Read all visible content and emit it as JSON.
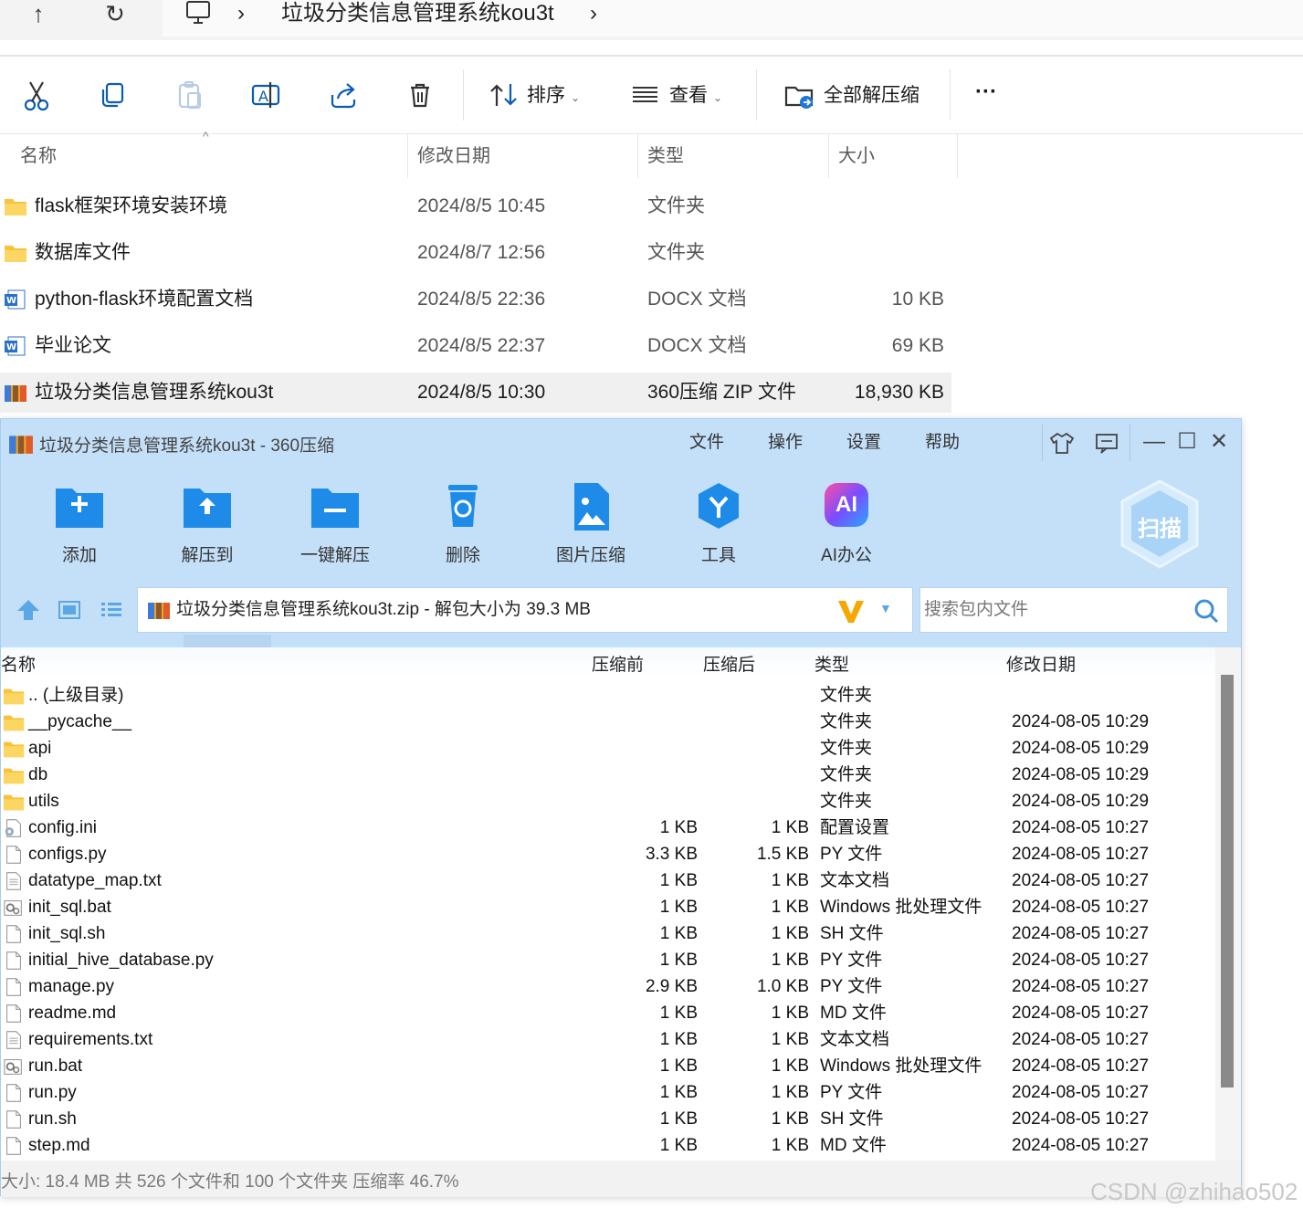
{
  "explorer": {
    "breadcrumb": {
      "segment": "垃圾分类信息管理系统kou3t"
    },
    "nav": {
      "up": "↑",
      "refresh": "↻",
      "sep1": "›",
      "sep2": "›"
    },
    "commands": {
      "sort_label": "排序",
      "view_label": "查看",
      "extract_all_label": "全部解压缩",
      "more_label": "···"
    },
    "columns": {
      "name": "名称",
      "date": "修改日期",
      "type": "类型",
      "size": "大小"
    },
    "files": [
      {
        "name": "flask框架环境安装环境",
        "date": "2024/8/5 10:45",
        "type": "文件夹",
        "size": "",
        "icon": "folder-icon"
      },
      {
        "name": "数据库文件",
        "date": "2024/8/7 12:56",
        "type": "文件夹",
        "size": "",
        "icon": "folder-icon"
      },
      {
        "name": "python-flask环境配置文档",
        "date": "2024/8/5 22:36",
        "type": "DOCX 文档",
        "size": "10 KB",
        "icon": "word-doc-icon"
      },
      {
        "name": "毕业论文",
        "date": "2024/8/5 22:37",
        "type": "DOCX 文档",
        "size": "69 KB",
        "icon": "word-doc-icon"
      },
      {
        "name": "垃圾分类信息管理系统kou3t",
        "date": "2024/8/5 10:30",
        "type": "360压缩 ZIP 文件",
        "size": "18,930 KB",
        "icon": "zip-archive-icon",
        "selected": true
      }
    ]
  },
  "zip": {
    "title": "垃圾分类信息管理系统kou3t - 360压缩",
    "menu": [
      "文件",
      "操作",
      "设置",
      "帮助"
    ],
    "window_controls": {
      "minimize": "—",
      "maximize": "☐",
      "close": "✕"
    },
    "toolbar": [
      "添加",
      "解压到",
      "一键解压",
      "删除",
      "图片压缩",
      "工具",
      "AI办公"
    ],
    "scan_label": "扫描",
    "ai_badge": "AI",
    "path_text": "垃圾分类信息管理系统kou3t.zip - 解包大小为 39.3 MB",
    "search_placeholder": "搜索包内文件",
    "columns": {
      "name": "名称",
      "before": "压缩前",
      "after": "压缩后",
      "type": "类型",
      "date": "修改日期"
    },
    "rows": [
      {
        "name": ".. (上级目录)",
        "before": "",
        "after": "",
        "type": "文件夹",
        "date": "",
        "icon": "folder-icon"
      },
      {
        "name": "__pycache__",
        "before": "",
        "after": "",
        "type": "文件夹",
        "date": "2024-08-05 10:29",
        "icon": "folder-icon"
      },
      {
        "name": "api",
        "before": "",
        "after": "",
        "type": "文件夹",
        "date": "2024-08-05 10:29",
        "icon": "folder-icon"
      },
      {
        "name": "db",
        "before": "",
        "after": "",
        "type": "文件夹",
        "date": "2024-08-05 10:29",
        "icon": "folder-icon"
      },
      {
        "name": "utils",
        "before": "",
        "after": "",
        "type": "文件夹",
        "date": "2024-08-05 10:29",
        "icon": "folder-icon"
      },
      {
        "name": "config.ini",
        "before": "1 KB",
        "after": "1 KB",
        "type": "配置设置",
        "date": "2024-08-05 10:27",
        "icon": "settings-file-icon"
      },
      {
        "name": "configs.py",
        "before": "3.3 KB",
        "after": "1.5 KB",
        "type": "PY 文件",
        "date": "2024-08-05 10:27",
        "icon": "file-icon"
      },
      {
        "name": "datatype_map.txt",
        "before": "1 KB",
        "after": "1 KB",
        "type": "文本文档",
        "date": "2024-08-05 10:27",
        "icon": "text-file-icon"
      },
      {
        "name": "init_sql.bat",
        "before": "1 KB",
        "after": "1 KB",
        "type": "Windows 批处理文件",
        "date": "2024-08-05 10:27",
        "icon": "batch-file-icon"
      },
      {
        "name": "init_sql.sh",
        "before": "1 KB",
        "after": "1 KB",
        "type": "SH 文件",
        "date": "2024-08-05 10:27",
        "icon": "file-icon"
      },
      {
        "name": "initial_hive_database.py",
        "before": "1 KB",
        "after": "1 KB",
        "type": "PY 文件",
        "date": "2024-08-05 10:27",
        "icon": "file-icon"
      },
      {
        "name": "manage.py",
        "before": "2.9 KB",
        "after": "1.0 KB",
        "type": "PY 文件",
        "date": "2024-08-05 10:27",
        "icon": "file-icon"
      },
      {
        "name": "readme.md",
        "before": "1 KB",
        "after": "1 KB",
        "type": "MD 文件",
        "date": "2024-08-05 10:27",
        "icon": "file-icon"
      },
      {
        "name": "requirements.txt",
        "before": "1 KB",
        "after": "1 KB",
        "type": "文本文档",
        "date": "2024-08-05 10:27",
        "icon": "text-file-icon"
      },
      {
        "name": "run.bat",
        "before": "1 KB",
        "after": "1 KB",
        "type": "Windows 批处理文件",
        "date": "2024-08-05 10:27",
        "icon": "batch-file-icon"
      },
      {
        "name": "run.py",
        "before": "1 KB",
        "after": "1 KB",
        "type": "PY 文件",
        "date": "2024-08-05 10:27",
        "icon": "file-icon"
      },
      {
        "name": "run.sh",
        "before": "1 KB",
        "after": "1 KB",
        "type": "SH 文件",
        "date": "2024-08-05 10:27",
        "icon": "file-icon"
      },
      {
        "name": "step.md",
        "before": "1 KB",
        "after": "1 KB",
        "type": "MD 文件",
        "date": "2024-08-05 10:27",
        "icon": "file-icon"
      }
    ],
    "status": "大小: 18.4 MB 共 526 个文件和 100 个文件夹 压缩率 46.7%"
  },
  "watermark": "CSDN @zhihao502",
  "colors": {
    "zip_bg": "#c4e0f9",
    "accent_blue": "#1e8ee8",
    "folder_yellow": "#f8c33b"
  }
}
